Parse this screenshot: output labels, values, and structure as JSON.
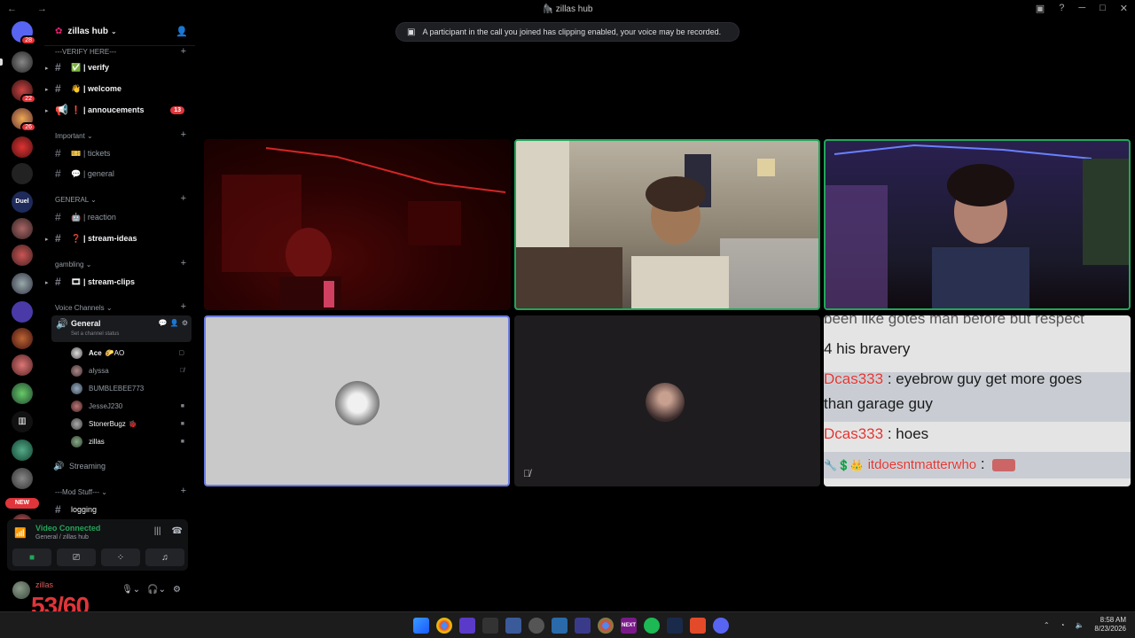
{
  "window": {
    "title": "zillas hub"
  },
  "toast": {
    "text": "A participant in the call you joined has clipping enabled, your voice may be recorded."
  },
  "rail": {
    "badges": [
      "28",
      "22",
      "26"
    ],
    "duel_label": "Duel",
    "new_label": "NEW"
  },
  "server": {
    "name": "zillas hub"
  },
  "categories": {
    "verify": "---VERIFY HERE---",
    "important": "Important",
    "general": "GENERAL",
    "gambling": "gambling",
    "voice": "Voice Channels",
    "mod": "---Mod Stuff---"
  },
  "channels": {
    "verify": "| verify",
    "welcome": "| welcome",
    "announcements": "| annoucements",
    "announcements_badge": "13",
    "tickets": "| tickets",
    "general": "| general",
    "reaction": "| reaction",
    "stream_ideas": "| stream-ideas",
    "stream_clips": "| stream-clips",
    "logging": "logging",
    "streaming": "Streaming"
  },
  "voice_channel": {
    "name": "General",
    "status_placeholder": "Set a channel status",
    "users": [
      "Ace",
      "alyssa",
      "BUMBLEBEE773",
      "JesseJ230",
      "StonerBugz",
      "zillas"
    ],
    "ace_tag": "AO"
  },
  "voice_panel": {
    "status": "Video Connected",
    "location": "General / zillas hub"
  },
  "user_panel": {
    "name": "zillas"
  },
  "overlay_counter": "53/60",
  "chat": {
    "line1": "been like gotes man before but respect",
    "line2": "4 his bravery",
    "user1": "Dcas333",
    "msg1a": " : eyebrow guy get more goes",
    "msg1b": "than garage guy",
    "user2": "Dcas333",
    "msg2": " : hoes",
    "user3": "itdoesntmatterwho",
    "msg3": " :"
  },
  "taskbar": {
    "time": "8:58 AM",
    "date": "8/23/2026",
    "next_label": "NEXT"
  }
}
